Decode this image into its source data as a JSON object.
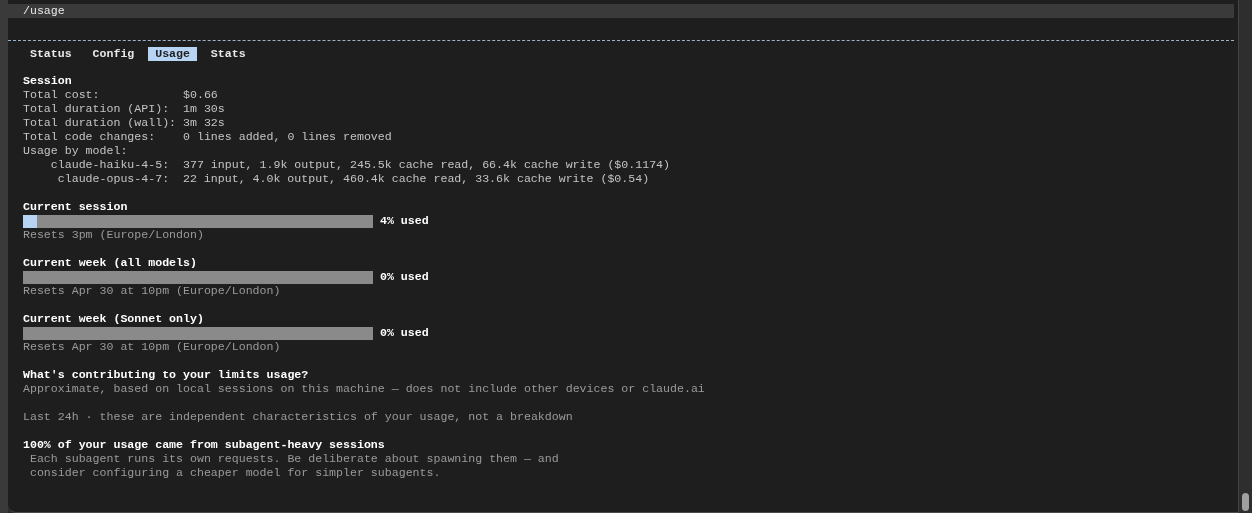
{
  "prompt": {
    "text": "/usage"
  },
  "tabs": [
    {
      "label": "Status",
      "selected": false
    },
    {
      "label": "Config",
      "selected": false
    },
    {
      "label": "Usage",
      "selected": true
    },
    {
      "label": "Stats",
      "selected": false
    }
  ],
  "session": {
    "title": "Session",
    "rows": [
      {
        "label": "Total cost:",
        "value": "$0.66"
      },
      {
        "label": "Total duration (API):",
        "value": "1m 30s"
      },
      {
        "label": "Total duration (wall):",
        "value": "3m 32s"
      },
      {
        "label": "Total code changes:",
        "value": "0 lines added, 0 lines removed"
      }
    ],
    "models_label": "Usage by model:",
    "models": [
      {
        "name": "claude-haiku-4-5:",
        "stats": "377 input, 1.9k output, 245.5k cache read, 66.4k cache write ($0.1174)"
      },
      {
        "name": "claude-opus-4-7:",
        "stats": "22 input, 4.0k output, 460.4k cache read, 33.6k cache write ($0.54)"
      }
    ]
  },
  "limits": [
    {
      "title": "Current session",
      "level": 0.04,
      "reading": "4% used",
      "resets": "Resets 3pm (Europe/London)"
    },
    {
      "title": "Current week (all models)",
      "level": 0,
      "reading": "0% used",
      "resets": "Resets Apr 30 at 10pm (Europe/London)"
    },
    {
      "title": "Current week (Sonnet only)",
      "level": 0,
      "reading": "0% used",
      "resets": "Resets Apr 30 at 10pm (Europe/London)"
    }
  ],
  "contributing": {
    "title": "What's contributing to your limits usage?",
    "note": "Approximate, based on local sessions on this machine — does not include other devices or claude.ai",
    "period": "Last 24h · these are independent characteristics of your usage, not a breakdown",
    "finding_title": "100% of your usage came from subagent-heavy sessions",
    "finding_lines": [
      "Each subagent runs its own requests. Be deliberate about spawning them — and",
      "consider configuring a cheaper model for simpler subagents."
    ]
  }
}
